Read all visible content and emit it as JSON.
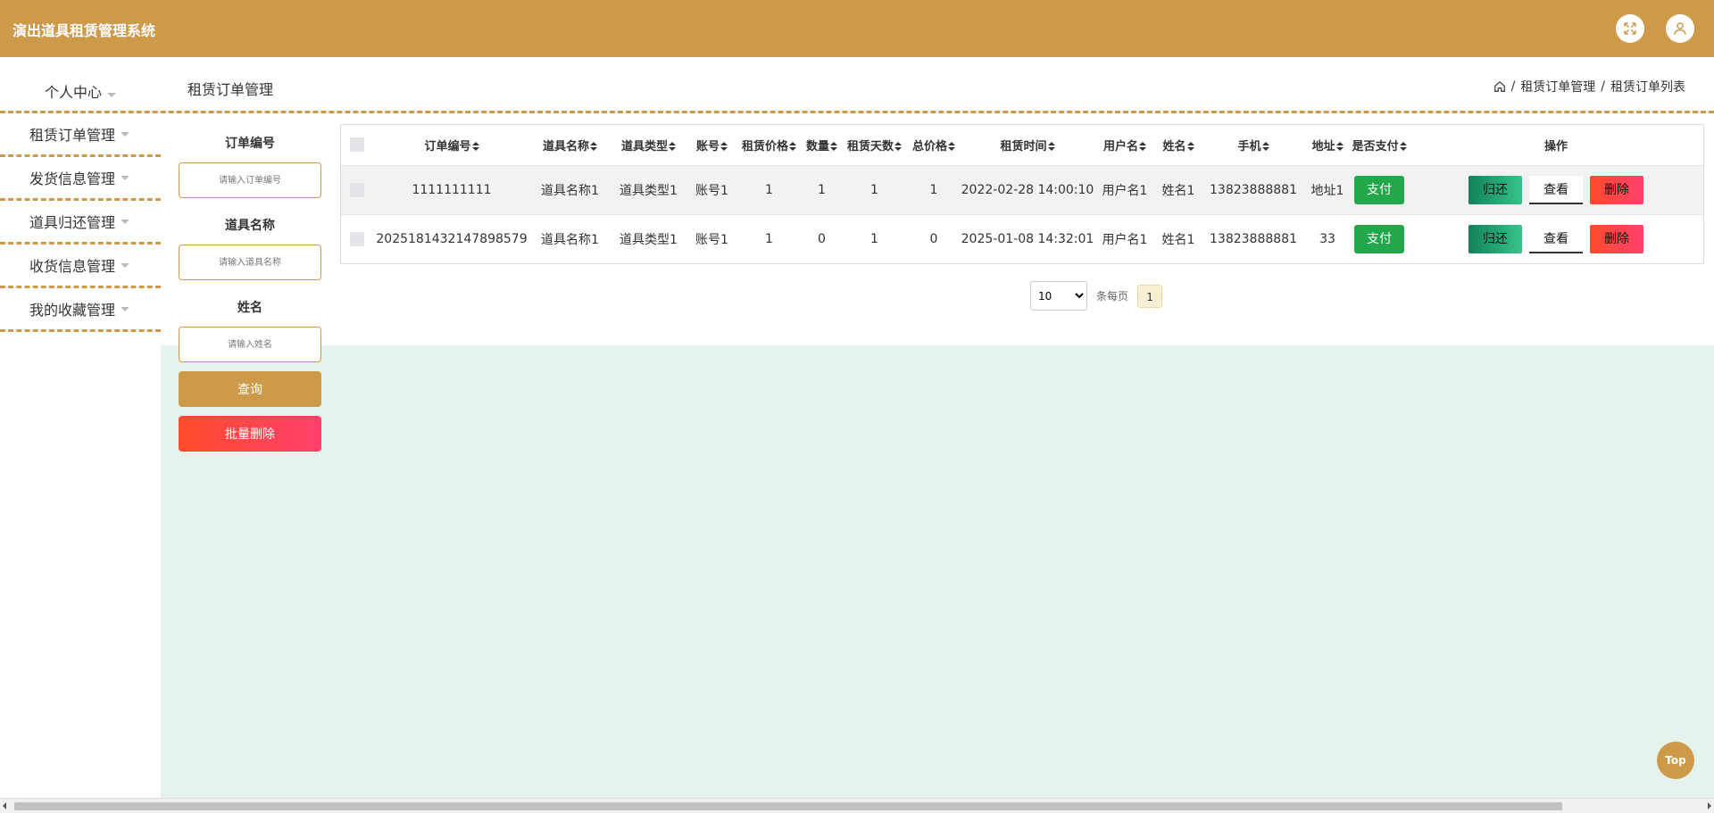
{
  "app": {
    "title": "演出道具租赁管理系统"
  },
  "header": {
    "fullscreen_icon": "fullscreen-icon",
    "user_icon": "user-icon"
  },
  "sidebar": {
    "personal_center": "个人中心",
    "items": [
      {
        "label": "租赁订单管理"
      },
      {
        "label": "发货信息管理"
      },
      {
        "label": "道具归还管理"
      },
      {
        "label": "收货信息管理"
      },
      {
        "label": "我的收藏管理"
      }
    ]
  },
  "page": {
    "title": "租赁订单管理",
    "breadcrumb": [
      "租赁订单管理",
      "租赁订单列表"
    ],
    "breadcrumb_sep": "/"
  },
  "search": {
    "order_no_label": "订单编号",
    "order_no_placeholder": "请输入订单编号",
    "order_no_value": "",
    "prop_name_label": "道具名称",
    "prop_name_placeholder": "请输入道具名称",
    "prop_name_value": "",
    "name_label": "姓名",
    "name_placeholder": "请输入姓名",
    "name_value": "",
    "query_label": "查询",
    "batch_delete_label": "批量删除"
  },
  "table": {
    "columns": [
      "订单编号",
      "道具名称",
      "道具类型",
      "账号",
      "租赁价格",
      "数量",
      "租赁天数",
      "总价格",
      "租赁时间",
      "用户名",
      "姓名",
      "手机",
      "地址",
      "是否支付",
      "操作"
    ],
    "rows": [
      {
        "order_no": "1111111111",
        "prop_name": "道具名称1",
        "prop_type": "道具类型1",
        "account": "账号1",
        "price": "1",
        "quantity": "1",
        "days": "1",
        "total": "1",
        "time": "2022-02-28 14:00:10",
        "username": "用户名1",
        "name": "姓名1",
        "phone": "13823888881",
        "address": "地址1",
        "pay_label": "支付"
      },
      {
        "order_no": "2025181432147898579",
        "prop_name": "道具名称1",
        "prop_type": "道具类型1",
        "account": "账号1",
        "price": "1",
        "quantity": "0",
        "days": "1",
        "total": "0",
        "time": "2025-01-08 14:32:01",
        "username": "用户名1",
        "name": "姓名1",
        "phone": "13823888881",
        "address": "33",
        "pay_label": "支付"
      }
    ],
    "actions": {
      "return": "归还",
      "view": "查看",
      "delete": "删除"
    }
  },
  "pagination": {
    "page_size": "10",
    "page_size_options": [
      "10"
    ],
    "per_page_label": "条每页",
    "current_page": "1"
  },
  "top_button": "Top",
  "colors": {
    "accent": "#cd9a4a",
    "success": "#22a84a",
    "danger": "#ff4b2b",
    "content_bg": "#e6f2ec"
  }
}
